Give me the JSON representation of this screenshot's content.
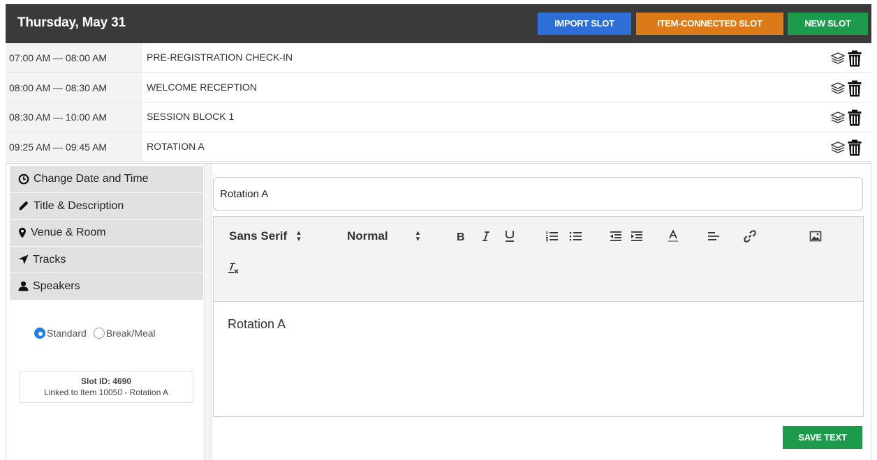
{
  "header": {
    "date": "Thursday, May 31",
    "import_label": "IMPORT SLOT",
    "item_connected_label": "ITEM-CONNECTED SLOT",
    "new_label": "NEW SLOT"
  },
  "colors": {
    "header_bg": "#3a3a3a",
    "import": "#2d6fd6",
    "item_connected": "#dc7a1a",
    "new": "#1e9a4c",
    "radio_active": "#1f7fe8"
  },
  "slots": [
    {
      "time": "07:00 AM — 08:00 AM",
      "title": "PRE-REGISTRATION CHECK-IN"
    },
    {
      "time": "08:00 AM — 08:30 AM",
      "title": "WELCOME RECEPTION"
    },
    {
      "time": "08:30 AM — 10:00 AM",
      "title": "SESSION BLOCK 1"
    },
    {
      "time": "09:25 AM — 09:45 AM",
      "title": "ROTATION A"
    }
  ],
  "slot_icons": [
    "layers-icon",
    "trash-icon"
  ],
  "tabs": [
    {
      "label": "Change Date and Time",
      "icon": "clock-icon"
    },
    {
      "label": "Title & Description",
      "icon": "pencil-icon"
    },
    {
      "label": "Venue & Room",
      "icon": "map-pin-icon"
    },
    {
      "label": "Tracks",
      "icon": "location-arrow-icon"
    },
    {
      "label": "Speakers",
      "icon": "user-icon"
    }
  ],
  "slot_type": {
    "options": [
      "Standard",
      "Break/Meal"
    ],
    "selected": "Standard"
  },
  "slot_info": {
    "id_label": "Slot ID: 4690",
    "linked": "Linked to Item 10050 - Rotation A"
  },
  "editor": {
    "title_value": "Rotation A",
    "font_family": "Sans Serif",
    "font_size": "Normal",
    "body_text": "Rotation A",
    "toolbar_icons": [
      "bold-icon",
      "italic-icon",
      "underline-icon",
      "ordered-list-icon",
      "bullet-list-icon",
      "outdent-icon",
      "indent-icon",
      "text-color-icon",
      "align-icon",
      "link-icon",
      "image-icon",
      "clear-format-icon"
    ],
    "save_label": "SAVE TEXT"
  }
}
